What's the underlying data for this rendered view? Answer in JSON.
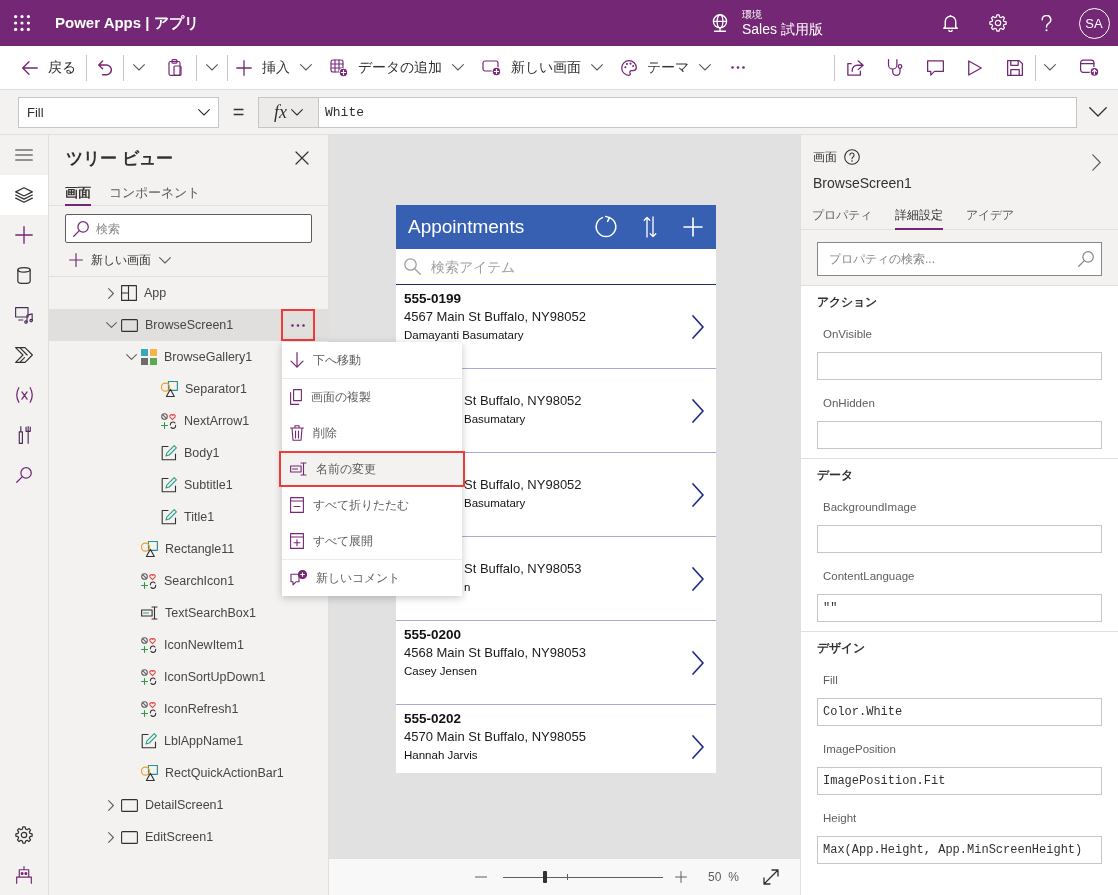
{
  "header": {
    "title": "Power Apps | アプリ",
    "environment_label": "環境",
    "environment_name": "Sales 試用版",
    "avatar_initials": "SA"
  },
  "toolbar": {
    "buttons": [
      {
        "label": "戻る",
        "dropdown": false
      },
      {
        "label": "挿入",
        "dropdown": true
      },
      {
        "label": "データの追加",
        "dropdown": true
      },
      {
        "label": "新しい画面",
        "dropdown": true
      },
      {
        "label": "テーマ",
        "dropdown": true
      }
    ]
  },
  "formula_bar": {
    "property": "Fill",
    "equals": "=",
    "function_label": "fx",
    "formula": "White"
  },
  "rail": {
    "items": [
      {
        "selected": true
      },
      {
        "selected": false
      },
      {
        "selected": false
      },
      {
        "selected": false
      },
      {
        "selected": false
      },
      {
        "selected": false
      },
      {
        "selected": false
      },
      {
        "selected": false
      }
    ]
  },
  "tree": {
    "title": "ツリー ビュー",
    "tabs": [
      {
        "label": "画面",
        "selected": true
      },
      {
        "label": "コンポーネント",
        "selected": false
      }
    ],
    "search_placeholder": "検索",
    "new_screen_label": "新しい画面",
    "nodes": [
      {
        "label": "App",
        "kind": "app",
        "selected": false,
        "expanded": false
      },
      {
        "label": "BrowseScreen1",
        "kind": "screen",
        "selected": true,
        "expanded": true,
        "children": [
          {
            "label": "BrowseGallery1",
            "kind": "gallery",
            "selected": false,
            "expanded": true,
            "children": [
              {
                "label": "Separator1",
                "kind": "shape",
                "selected": false
              },
              {
                "label": "NextArrow1",
                "kind": "icon",
                "selected": false
              },
              {
                "label": "Body1",
                "kind": "label",
                "selected": false
              },
              {
                "label": "Subtitle1",
                "kind": "label",
                "selected": false
              },
              {
                "label": "Title1",
                "kind": "label",
                "selected": false
              }
            ]
          },
          {
            "label": "Rectangle11",
            "kind": "shape",
            "selected": false
          },
          {
            "label": "SearchIcon1",
            "kind": "icon",
            "selected": false
          },
          {
            "label": "TextSearchBox1",
            "kind": "text-input",
            "selected": false
          },
          {
            "label": "IconNewItem1",
            "kind": "icon",
            "selected": false
          },
          {
            "label": "IconSortUpDown1",
            "kind": "icon",
            "selected": false
          },
          {
            "label": "IconRefresh1",
            "kind": "icon",
            "selected": false
          },
          {
            "label": "LblAppName1",
            "kind": "label",
            "selected": false
          },
          {
            "label": "RectQuickActionBar1",
            "kind": "shape",
            "selected": false
          }
        ]
      },
      {
        "label": "DetailScreen1",
        "kind": "screen",
        "selected": false,
        "expanded": false
      },
      {
        "label": "EditScreen1",
        "kind": "screen",
        "selected": false,
        "expanded": false
      }
    ]
  },
  "context_menu": {
    "groups": [
      {
        "items": [
          {
            "label": "下へ移動",
            "highlighted": false
          }
        ]
      },
      {
        "items": [
          {
            "label": "画面の複製",
            "highlighted": false
          },
          {
            "label": "削除",
            "highlighted": false
          },
          {
            "label": "名前の変更",
            "highlighted": true
          },
          {
            "label": "すべて折りたたむ",
            "highlighted": false
          },
          {
            "label": "すべて展開",
            "highlighted": false
          }
        ]
      },
      {
        "items": [
          {
            "label": "新しいコメント",
            "highlighted": false
          }
        ]
      }
    ]
  },
  "app_preview": {
    "title": "Appointments",
    "search_placeholder": "検索アイテム",
    "items": [
      {
        "kind": "full",
        "title": "555-0199",
        "address": "4567 Main St Buffalo, NY98052",
        "name": "Damayanti Basumatary"
      },
      {
        "kind": "covered",
        "address": "St Buffalo, NY98052",
        "name": "Basumatary"
      },
      {
        "kind": "covered",
        "address": "St Buffalo, NY98052",
        "name": "Basumatary"
      },
      {
        "kind": "covered",
        "address": "St Buffalo, NY98053",
        "name": "n"
      },
      {
        "kind": "full",
        "title": "555-0200",
        "address": "4568 Main St Buffalo, NY98053",
        "name": "Casey Jensen"
      },
      {
        "kind": "full",
        "title": "555-0202",
        "address": "4570 Main St Buffalo, NY98055",
        "name": "Hannah Jarvis"
      }
    ]
  },
  "zoom": {
    "level": 0.26,
    "value": "50",
    "unit": "%"
  },
  "properties": {
    "type_label": "画面",
    "name": "BrowseScreen1",
    "tabs": [
      {
        "label": "プロパティ",
        "selected": false
      },
      {
        "label": "詳細設定",
        "selected": true
      },
      {
        "label": "アイデア",
        "selected": false
      }
    ],
    "search_placeholder": "プロパティの検索...",
    "sections": [
      {
        "title": "アクション",
        "properties": [
          {
            "label": "OnVisible"
          },
          {
            "label": "OnHidden"
          }
        ]
      },
      {
        "title": "データ",
        "properties": [
          {
            "label": "BackgroundImage"
          },
          {
            "label": "ContentLanguage",
            "value": "\"\""
          }
        ]
      },
      {
        "title": "デザイン",
        "properties": [
          {
            "label": "Fill",
            "value": "Color.White"
          },
          {
            "label": "ImagePosition",
            "value": "ImagePosition.Fit"
          },
          {
            "label": "Height",
            "value": "Max(App.Height, App.MinScreenHeight)"
          }
        ]
      }
    ]
  }
}
